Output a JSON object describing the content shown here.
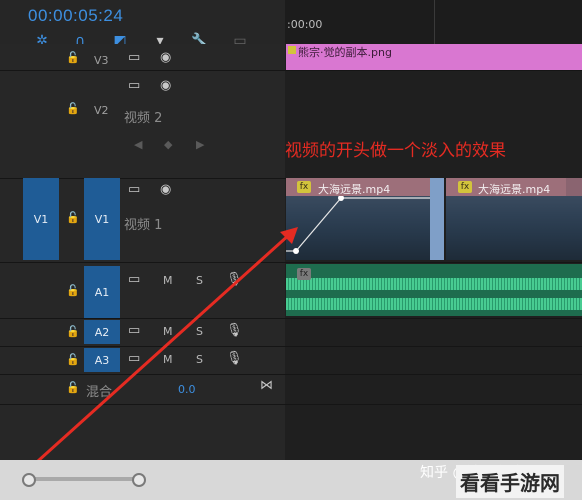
{
  "header": {
    "timecode": "00:00:05:24",
    "tools": [
      "snap-icon",
      "magnet-icon",
      "linked-selection-icon",
      "marker-icon",
      "wrench-icon",
      "captions-icon"
    ]
  },
  "ruler": {
    "label": ":00:00"
  },
  "tracks": {
    "v3": {
      "label": "V3"
    },
    "v2": {
      "label": "V2",
      "name": "视频 2"
    },
    "v1": {
      "source_label": "V1",
      "label": "V1",
      "name": "视频 1"
    },
    "a1": {
      "label": "A1",
      "m": "M",
      "s": "S"
    },
    "a2": {
      "label": "A2",
      "m": "M",
      "s": "S"
    },
    "a3": {
      "label": "A3",
      "m": "M",
      "s": "S"
    },
    "mix": {
      "label": "混合",
      "value": "0.0"
    }
  },
  "clips": {
    "v3_clip": "熊宗·觉的副本.png",
    "v1_clip_a": "大海远景.mp4",
    "v1_clip_b": "大海远景.mp4",
    "fx": "fx"
  },
  "annotation": "视频的开头做一个淡入的效果",
  "watermark": "知乎 @锦瑟和诗琳",
  "corner_logo": "看看手游网",
  "colors": {
    "accent_blue": "#3d8fe0",
    "annotation_red": "#e52b22",
    "clip_pink": "#d977d1",
    "audio_green": "#2a9f6f"
  }
}
